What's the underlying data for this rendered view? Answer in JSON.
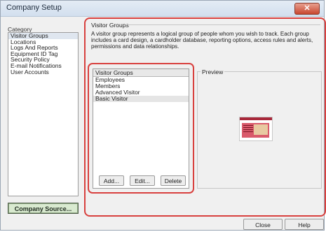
{
  "window": {
    "title": "Company Setup",
    "close_symbol": "✕"
  },
  "category": {
    "label": "Category",
    "items": [
      "Visitor Groups",
      "Locations",
      "Logs And Reports",
      "Equipment ID Tag",
      "Security Policy",
      "E-mail Notifications",
      "User Accounts"
    ],
    "selected_index": 0
  },
  "company_source_button": "Company Source...",
  "visitor_groups_panel": {
    "title": "Visitor Groups",
    "description": "A visitor group represents a logical group of people whom you wish to track. Each group includes a card design, a cardholder database, reporting options, access rules and alerts, permissions and data relationships.",
    "list_header": "Visitor Groups",
    "groups": [
      "Employees",
      "Members",
      "Advanced Visitor",
      "Basic Visitor"
    ],
    "selected_index": 3,
    "buttons": {
      "add": "Add...",
      "edit": "Edit...",
      "delete": "Delete"
    }
  },
  "preview": {
    "label": "Preview"
  },
  "footer": {
    "close": "Close",
    "help": "Help"
  },
  "colors": {
    "highlight_outline": "#d8403e",
    "company_source_bg": "#d9ead0",
    "card_accent": "#d95a6b"
  }
}
